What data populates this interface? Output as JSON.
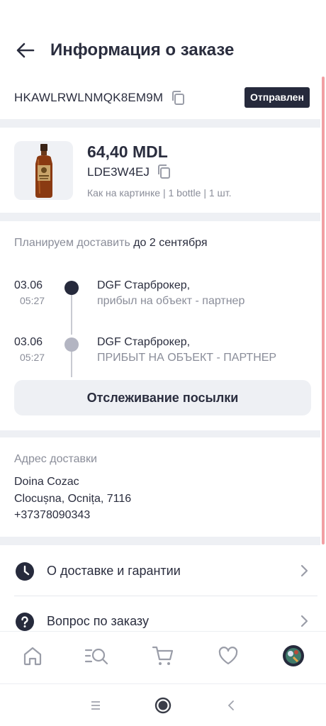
{
  "header": {
    "title": "Информация о заказе"
  },
  "order": {
    "id": "HKAWLRWLNMQK8EM9M",
    "status": "Отправлен"
  },
  "product": {
    "price": "64,40 MDL",
    "sku": "LDE3W4EJ",
    "variant": "Как на картинке | 1 bottle  | 1 шт."
  },
  "delivery": {
    "plan_prefix": "Планируем доставить ",
    "plan_date": "до 2 сентября",
    "timeline": [
      {
        "date": "03.06",
        "time": "05:27",
        "title": "DGF Старброкер,",
        "subtitle": "прибыл на объект - партнер"
      },
      {
        "date": "03.06",
        "time": "05:27",
        "title": "DGF Старброкер,",
        "subtitle": "ПРИБЫТ НА ОБЪЕКТ - ПАРТНЕР"
      }
    ],
    "track_button": "Отслеживание посылки"
  },
  "address": {
    "label": "Адрес доставки",
    "name": "Doina Cozac",
    "city": "Clocușna, Ocnița, 7116",
    "phone": "+37378090343"
  },
  "menu": {
    "items": [
      {
        "label": "О доставке и гарантии",
        "icon": "clock-icon"
      },
      {
        "label": "Вопрос по заказу",
        "icon": "question-icon"
      }
    ]
  },
  "tabbar": {
    "icons": [
      "home-icon",
      "catalog-search-icon",
      "cart-icon",
      "heart-icon",
      "avatar"
    ]
  },
  "colors": {
    "dark": "#262a3c",
    "muted": "#8a8d99",
    "accent_scroll": "#f2a0a4",
    "divider": "#eef0f4"
  }
}
